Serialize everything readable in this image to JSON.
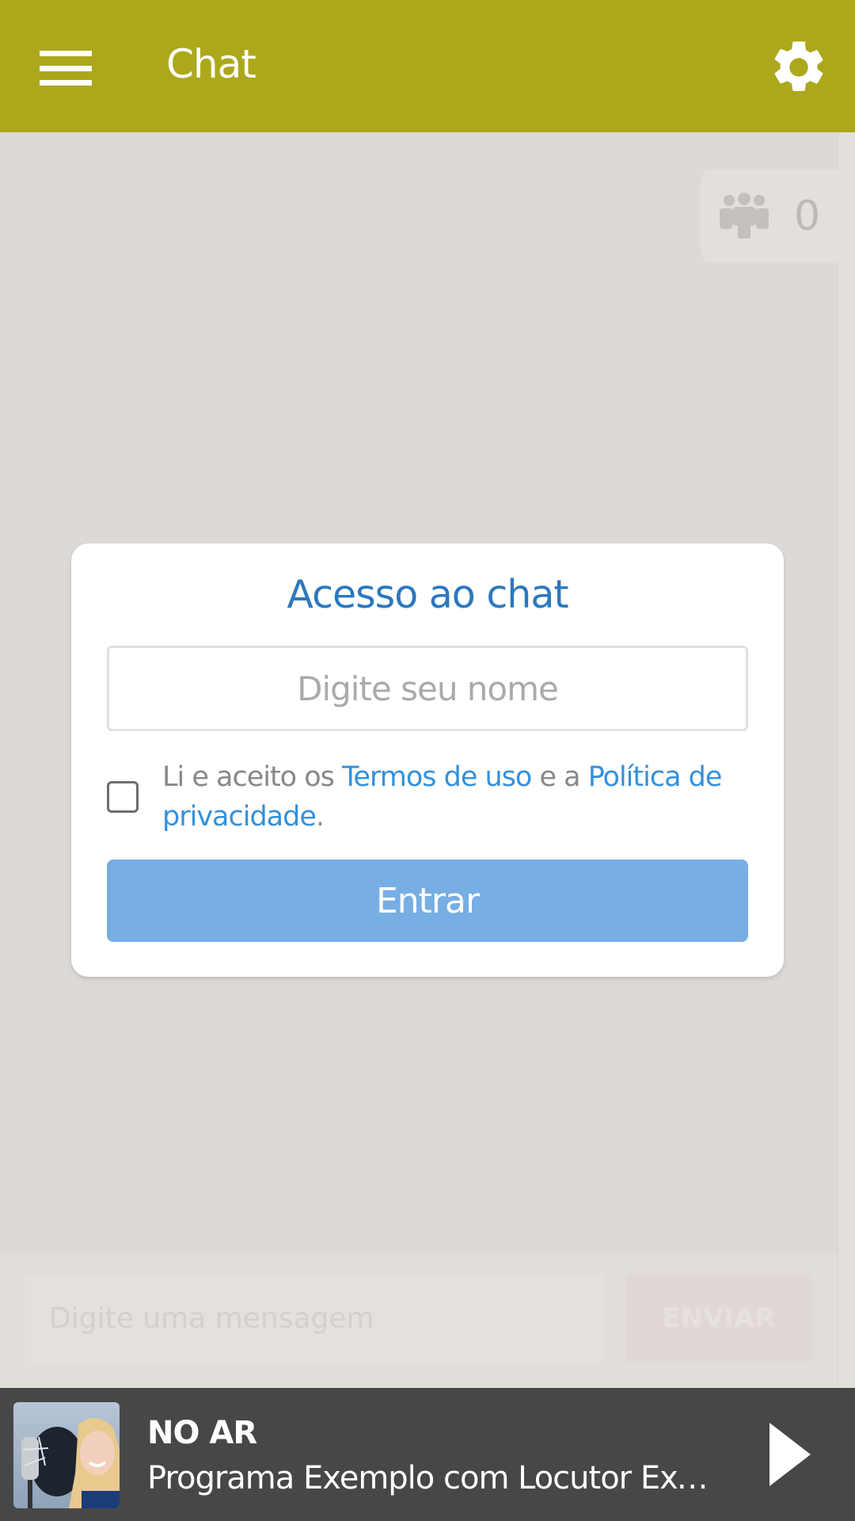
{
  "header": {
    "title": "Chat",
    "menu_icon": "hamburger-menu-icon",
    "settings_icon": "gear-icon",
    "color": "#aca81b"
  },
  "users": {
    "icon": "users-group-icon",
    "count": "0"
  },
  "login_card": {
    "title": "Acesso ao chat",
    "name_placeholder": "Digite seu nome",
    "name_value": "",
    "terms_prefix": "Li e aceito os ",
    "terms_link": "Termos de uso",
    "terms_middle": " e a ",
    "privacy_link": "Política de privacidade",
    "terms_suffix": ".",
    "accepted": false,
    "submit_label": "Entrar",
    "title_color": "#2d78bd",
    "link_color": "#3590d9",
    "button_color": "#77aee3"
  },
  "message_bar": {
    "placeholder": "Digite uma mensagem",
    "send_label": "ENVIAR"
  },
  "player": {
    "status_label": "NO AR",
    "program": "Programa Exemplo com Locutor Exemplo",
    "cover_icon": "program-cover-image",
    "play_icon": "play-icon"
  }
}
